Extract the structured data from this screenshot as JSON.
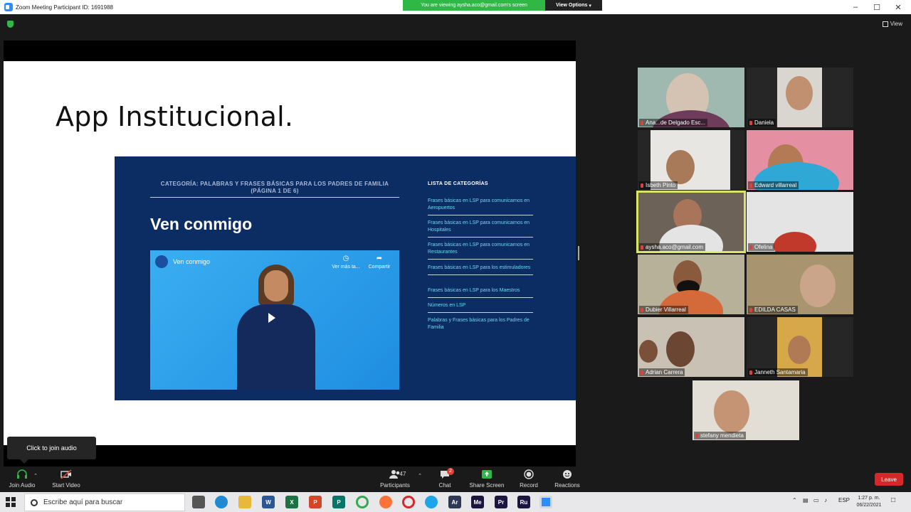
{
  "window": {
    "title": "Zoom Meeting Participant ID: 1691988",
    "share_banner": "You are viewing aysha.aco@gmail.com's screen",
    "view_options": "View Options",
    "minimize": "–",
    "maximize": "☐",
    "close": "✕",
    "view_label": "View"
  },
  "slide": {
    "title": "App Institucional.",
    "category_heading": "CATEGORÍA: PALABRAS Y FRASES BÁSICAS PARA LOS PADRES DE FAMILIA (PÁGINA 1 DE 6)",
    "lesson_title": "Ven conmigo",
    "video": {
      "title": "Ven conmigo",
      "watch_later": "Ver más ta...",
      "share": "Compartir"
    },
    "list_heading": "LISTA DE CATEGORÍAS",
    "categories": [
      "Frases básicas en LSP para comunicarnos en Aeropuertos",
      "Frases básicas en LSP para comunicarnos en Hospitales",
      "Frases básicas en LSP para comunicarnos en Restaurantes",
      "Frases básicas en LSP para los estimuladores",
      "Frases básicas en LSP para los Maestros",
      "Números en LSP",
      "Palabras y Frases básicas para los Padres de Familia"
    ]
  },
  "tooltip": "Click to join audio",
  "participants_tiles": [
    {
      "name": "Ana...de Delgado Esc...",
      "bg": "#9fb8b0",
      "active": false
    },
    {
      "name": "Daniela",
      "bg": "#3a3a3a",
      "active": false
    },
    {
      "name": "Isbeth Pinto",
      "bg": "#e8e6e2",
      "active": false
    },
    {
      "name": "Edward villarreal",
      "bg": "#e58fa2",
      "active": false
    },
    {
      "name": "aysha.aco@gmail.com",
      "bg": "#6d6258",
      "active": true
    },
    {
      "name": "Ofelina",
      "bg": "#e4e4e4",
      "active": false
    },
    {
      "name": "Dubier Villarreal",
      "bg": "#b8b19a",
      "active": false
    },
    {
      "name": "EDILDA CASAS",
      "bg": "#a8946e",
      "active": false
    },
    {
      "name": "Adrian Carrera",
      "bg": "#c9c2b4",
      "active": false
    },
    {
      "name": "Janneth Santamaria",
      "bg": "#d6a84a",
      "active": false
    },
    {
      "name": "stefany mendieta",
      "bg": "#e2ddd5",
      "active": false
    }
  ],
  "toolbar": {
    "join_audio": "Join Audio",
    "start_video": "Start Video",
    "participants": "Participants",
    "participants_count": "47",
    "chat": "Chat",
    "chat_badge": "2",
    "share_screen": "Share Screen",
    "record": "Record",
    "reactions": "Reactions",
    "leave": "Leave"
  },
  "taskbar": {
    "search_placeholder": "Escribe aquí para buscar",
    "apps": [
      "W",
      "X",
      "P",
      "P",
      "Ar",
      "Me",
      "Pr",
      "Ru"
    ],
    "language": "ESP",
    "time": "1:27 p. m.",
    "date": "06/22/2021"
  },
  "colors": {
    "share_green": "#2fb845",
    "panel_navy": "#0c2d63",
    "link_cyan": "#6fd6ee",
    "active_speaker": "#d9e46a",
    "leave_red": "#d8262b"
  }
}
